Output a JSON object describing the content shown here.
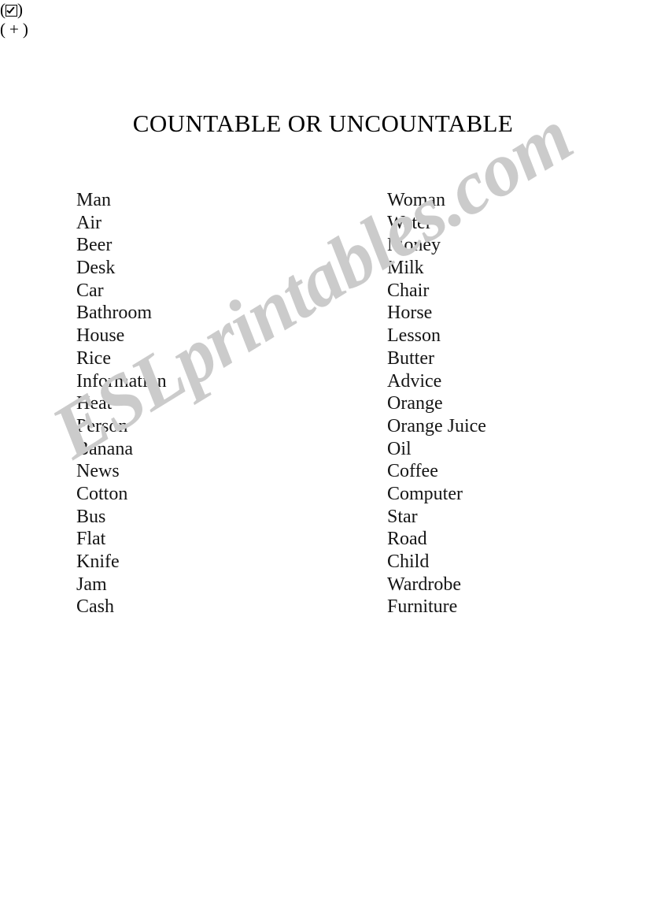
{
  "page": {
    "background_color": "#ffffff",
    "text_color": "#000000"
  },
  "header": {
    "title": "COUNTABLE OR UNCOUNTABLE",
    "countable_marker": {
      "open_paren": "(",
      "icon": "checkbox-checked-icon",
      "close_paren": ")"
    },
    "uncountable_marker": {
      "open_paren": "(",
      "symbol": "+",
      "close_paren": ")"
    }
  },
  "columns": {
    "countable": {
      "items": [
        "Man",
        "Air",
        "Beer",
        "Desk",
        "Car",
        "Bathroom",
        "House",
        "Rice",
        "Information",
        "Heat",
        "Person",
        "Banana",
        "News",
        "Cotton",
        "Bus",
        "Flat",
        "Knife",
        "Jam",
        "Cash"
      ]
    },
    "uncountable": {
      "items": [
        "Woman",
        "Water",
        "Money",
        "Milk",
        "Chair",
        "Horse",
        "Lesson",
        "Butter",
        "Advice",
        "Orange",
        "Orange Juice",
        "Oil",
        "Coffee",
        "Computer",
        "Star",
        "Road",
        "Child",
        "Wardrobe",
        "Furniture"
      ]
    }
  },
  "watermark": {
    "text": "ESLprintables.com",
    "color": "#cbcbcb"
  }
}
